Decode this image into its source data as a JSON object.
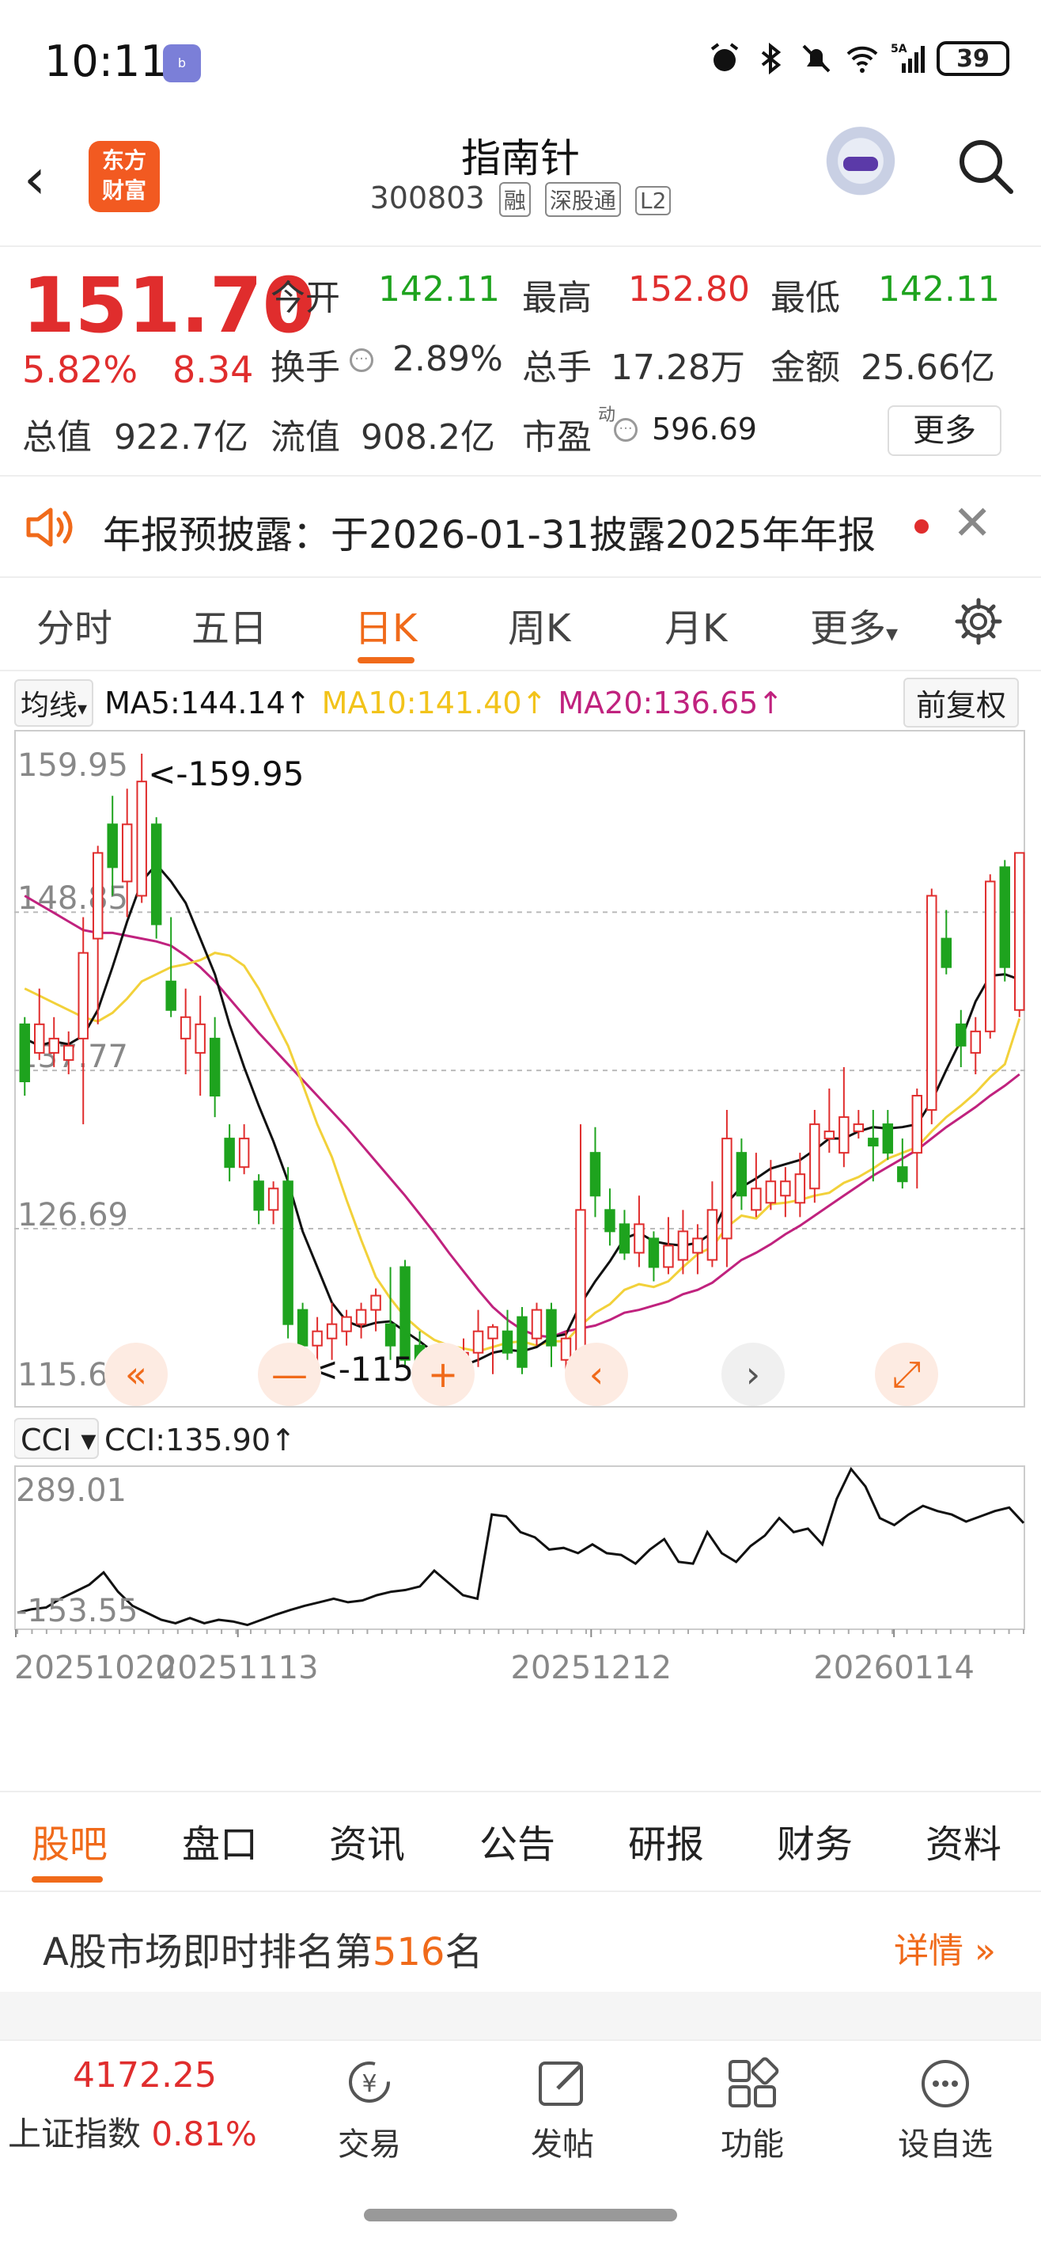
{
  "status_bar": {
    "time": "10:11",
    "app_badge": "bilibili",
    "battery": "39",
    "network": "5A"
  },
  "header": {
    "title": "指南针",
    "code": "300803",
    "tags": [
      "融",
      "深股通",
      "L2"
    ],
    "logo_line1": "东方",
    "logo_line2": "财富"
  },
  "quote": {
    "price": "151.70",
    "change_pct": "5.82%",
    "change": "8.34",
    "open_label": "今开",
    "open": "142.11",
    "high_label": "最高",
    "high": "152.80",
    "low_label": "最低",
    "low": "142.11",
    "turnover_label": "换手",
    "turnover": "2.89%",
    "volume_label": "总手",
    "volume": "17.28万",
    "amount_label": "金额",
    "amount": "25.66亿",
    "mcap_label": "总值",
    "mcap": "922.7亿",
    "float_label": "流值",
    "float_mcap": "908.2亿",
    "pe_label": "市盈",
    "pe_sup": "动",
    "pe": "596.69",
    "more_label": "更多"
  },
  "notice": {
    "text": "年报预披露：于2026-01-31披露2025年年报"
  },
  "period_tabs": [
    "分时",
    "五日",
    "日K",
    "周K",
    "月K",
    "更多"
  ],
  "period_active": "日K",
  "ma": {
    "selector": "均线",
    "ma5": "MA5:144.14↑",
    "ma10": "MA10:141.40↑",
    "ma20": "MA20:136.65↑",
    "adjust": "前复权"
  },
  "colors": {
    "up": "#e02d2d",
    "down": "#1ea31e",
    "accent": "#f06a1a",
    "ma5": "#111111",
    "ma10": "#f2d13a",
    "ma20": "#c0227e"
  },
  "chart_data": [
    {
      "type": "candlestick",
      "title": "日K",
      "ylim": [
        115.6,
        159.95
      ],
      "y_ticks": [
        "159.95",
        "148.85",
        "137.77",
        "126.69",
        "115.60"
      ],
      "max_label": "<-159.95",
      "min_label": "<-115.60",
      "x_ticks": [
        "20251020",
        "20251113",
        "20251212",
        "20260114"
      ],
      "candles": [
        [
          141,
          137,
          141.5,
          136
        ],
        [
          139,
          141,
          143.5,
          138.5
        ],
        [
          139,
          140,
          141.5,
          138
        ],
        [
          138.5,
          139.5,
          140.5,
          137.5
        ],
        [
          140,
          146,
          148.5,
          134
        ],
        [
          147,
          153,
          153.5,
          141
        ],
        [
          155,
          152,
          157,
          150
        ],
        [
          151,
          155,
          157.5,
          148.5
        ],
        [
          150,
          158,
          159.95,
          149.5
        ],
        [
          155,
          148,
          155.5,
          147
        ],
        [
          144,
          142,
          148.5,
          141.5
        ],
        [
          140,
          141.5,
          143.5,
          137.5
        ],
        [
          139,
          141,
          143,
          136
        ],
        [
          140,
          136,
          141.5,
          134.5
        ],
        [
          133,
          131,
          134,
          130
        ],
        [
          131,
          133,
          134,
          130.5
        ],
        [
          130,
          128,
          130.5,
          127
        ],
        [
          128,
          129.5,
          130,
          127
        ],
        [
          130,
          120,
          131,
          119
        ],
        [
          121,
          118.5,
          121.5,
          115.6
        ],
        [
          118.5,
          119.5,
          120.5,
          116
        ],
        [
          119,
          120,
          121.5,
          117.5
        ],
        [
          119.5,
          120.5,
          121,
          118.5
        ],
        [
          120,
          121,
          121.5,
          119
        ],
        [
          121,
          122,
          122.5,
          119.5
        ],
        [
          120,
          118.5,
          124,
          117.5
        ],
        [
          124,
          117.5,
          124.5,
          117
        ],
        [
          118.5,
          117,
          119.5,
          116.5
        ],
        [
          117,
          115.8,
          117.5,
          115.6
        ],
        [
          116,
          117,
          117.5,
          115.5
        ],
        [
          117,
          118,
          119,
          116.5
        ],
        [
          118,
          119.5,
          121,
          117
        ],
        [
          119,
          119.8,
          120,
          116.5
        ],
        [
          119.5,
          118,
          121,
          117.5
        ],
        [
          120.5,
          117,
          121.2,
          116.5
        ],
        [
          119,
          121,
          121.5,
          118.5
        ],
        [
          121,
          118.5,
          121.5,
          117
        ],
        [
          117.5,
          119,
          119.5,
          116.5
        ],
        [
          118,
          128,
          134,
          117.5
        ],
        [
          132,
          129,
          133.8,
          127.5
        ],
        [
          128,
          126.5,
          129.5,
          125.5
        ],
        [
          127,
          125,
          128,
          124.5
        ],
        [
          125,
          127,
          129,
          124
        ],
        [
          126,
          124,
          126.5,
          123
        ],
        [
          124,
          125.5,
          127.5,
          123.5
        ],
        [
          124.5,
          126.5,
          128,
          123.5
        ],
        [
          125,
          126,
          127,
          123.5
        ],
        [
          124.5,
          128,
          130,
          124
        ],
        [
          126,
          133,
          135,
          124
        ],
        [
          132,
          129,
          133,
          128
        ],
        [
          128,
          129.5,
          132,
          127.5
        ],
        [
          128.5,
          130,
          131.5,
          128
        ],
        [
          129,
          130,
          131,
          127.5
        ],
        [
          128.5,
          130.5,
          132,
          127.5
        ],
        [
          129.5,
          134,
          135,
          128.5
        ],
        [
          133,
          133.5,
          136.5,
          132
        ],
        [
          132,
          134.5,
          138,
          131
        ],
        [
          133.5,
          134,
          135,
          133
        ],
        [
          133,
          132.5,
          135,
          130
        ],
        [
          134,
          132,
          135,
          131.5
        ],
        [
          131,
          130,
          133,
          129.5
        ],
        [
          132,
          136,
          136.5,
          129.5
        ],
        [
          135,
          150,
          150.5,
          134
        ],
        [
          147,
          145,
          149,
          144.5
        ],
        [
          141,
          139.5,
          142,
          138
        ],
        [
          139,
          140.5,
          141.5,
          137.5
        ],
        [
          140.5,
          151,
          151.5,
          140
        ],
        [
          152,
          145,
          152.5,
          144
        ],
        [
          142,
          153,
          153,
          141.5
        ]
      ],
      "ma_series": [
        {
          "name": "MA5",
          "values": [
            140,
            139.5,
            139.8,
            139.6,
            140.2,
            142,
            145,
            148.2,
            151,
            152.2,
            151,
            149.5,
            147,
            144.5,
            141,
            138,
            135.3,
            132.8,
            130,
            126.5,
            124,
            121.5,
            120.2,
            119.8,
            120.1,
            120.2,
            119.5,
            118.8,
            118,
            117.2,
            117.1,
            117.5,
            118,
            118.2,
            118.1,
            118.4,
            119.1,
            119.3,
            121.4,
            123,
            124.4,
            126,
            126.4,
            125.8,
            125.6,
            125.5,
            125.7,
            126.4,
            128.5,
            129.6,
            130.2,
            130.9,
            131.2,
            131.5,
            132.2,
            133,
            133,
            133.5,
            133.8,
            133.7,
            133.8,
            134,
            135.6,
            137.8,
            139.9,
            142.6,
            144.4,
            144.5,
            144.14
          ]
        },
        {
          "name": "MA10",
          "values": [
            143.5,
            143,
            142.5,
            142,
            141.5,
            141.2,
            141.8,
            142.8,
            144,
            144.5,
            145,
            145.2,
            145.5,
            146,
            145.8,
            145.1,
            143.5,
            141.5,
            139.5,
            136.8,
            134,
            131.7,
            128.7,
            125.9,
            123.3,
            121.8,
            120.5,
            119.6,
            118.9,
            118.5,
            118.3,
            118.1,
            118.4,
            118.7,
            118.8,
            118.5,
            118.8,
            118.8,
            119.9,
            120.8,
            121.4,
            122.4,
            122.8,
            122.6,
            123,
            124,
            124.9,
            125.4,
            126.8,
            127.6,
            127.4,
            128.4,
            128.5,
            128.7,
            129,
            129.2,
            129.9,
            130.3,
            130.9,
            131.6,
            132,
            132.4,
            133.5,
            134.5,
            135.3,
            136.2,
            137.3,
            138.2,
            141.4
          ]
        },
        {
          "name": "MA20",
          "values": [
            150,
            149.4,
            148.8,
            148.2,
            147.6,
            147.4,
            147.4,
            147.2,
            147,
            146.8,
            146.5,
            145.8,
            145,
            144,
            142.8,
            141.6,
            140.4,
            139.3,
            138.2,
            137.1,
            136,
            134.9,
            133.8,
            132.6,
            131.4,
            130.2,
            129,
            127.7,
            126.4,
            125,
            123.7,
            122.4,
            121.2,
            120.3,
            119.6,
            119.2,
            119.1,
            119.5,
            119.7,
            119.9,
            120.3,
            120.8,
            121,
            121.3,
            121.6,
            122.1,
            122.4,
            122.9,
            123.7,
            124.5,
            125,
            125.6,
            126.3,
            126.9,
            127.6,
            128.3,
            129,
            129.7,
            130.4,
            131,
            131.6,
            132.2,
            133,
            133.8,
            134.5,
            135.2,
            136,
            136.7,
            137.5
          ]
        }
      ]
    },
    {
      "type": "line",
      "title": "CCI",
      "legend": "CCI:135.90↑",
      "ylim": [
        -153.55,
        289.01
      ],
      "y_ticks": [
        "289.01",
        "-153.55"
      ],
      "values": [
        -120,
        -110,
        -105,
        -80,
        -60,
        -40,
        -5,
        -60,
        -100,
        -120,
        -140,
        -150,
        -135,
        -150,
        -140,
        -145,
        -155,
        -140,
        -125,
        -112,
        -100,
        -90,
        -80,
        -90,
        -85,
        -70,
        -60,
        -55,
        -45,
        0,
        -35,
        -70,
        -80,
        160,
        155,
        110,
        95,
        60,
        65,
        50,
        75,
        50,
        45,
        20,
        60,
        90,
        25,
        20,
        110,
        50,
        25,
        70,
        100,
        150,
        110,
        120,
        75,
        205,
        290,
        240,
        150,
        130,
        160,
        185,
        170,
        160,
        140,
        155,
        170,
        180,
        135.9
      ]
    }
  ],
  "chart_controls": [
    "«",
    "—",
    "+",
    "‹",
    "›",
    "⤢"
  ],
  "bottom_tabs": [
    "股吧",
    "盘口",
    "资讯",
    "公告",
    "研报",
    "财务",
    "资料"
  ],
  "bottom_active": "股吧",
  "rank": {
    "prefix": "A股市场即时排名第",
    "number": "516",
    "suffix": "名",
    "detail": "详情 »"
  },
  "bottom_nav": {
    "index_value": "4172.25",
    "index_name": "上证指数",
    "index_pct": "0.81%",
    "items": [
      "交易",
      "发帖",
      "功能",
      "设自选"
    ]
  }
}
